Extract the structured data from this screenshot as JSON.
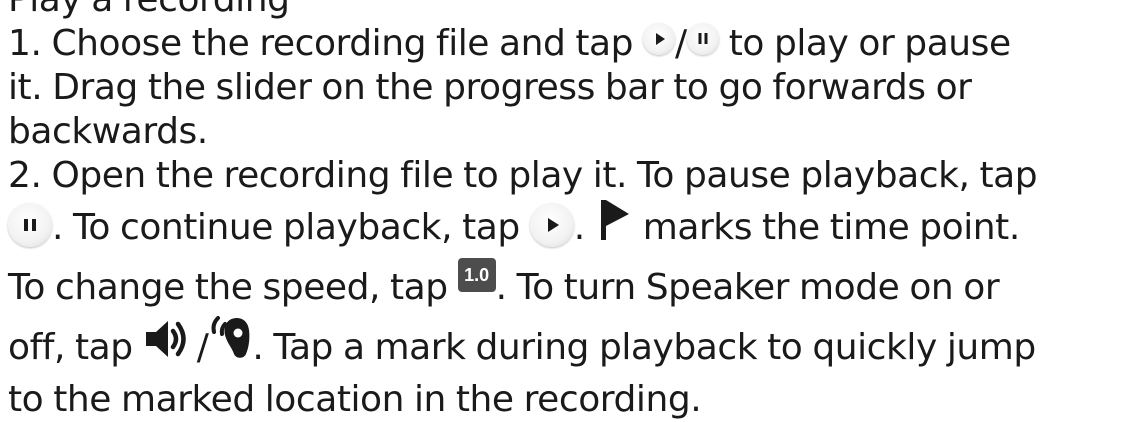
{
  "heading_partial": "Play a recording",
  "step1": {
    "before_icons": "1. Choose the recording file and tap ",
    "slash": "/",
    "after_icons": " to play or pause",
    "line2": "it. Drag the slider on the progress bar to go forwards or",
    "line3": "backwards."
  },
  "step2": {
    "line1": "2. Open the recording file to play it. To pause playback, tap",
    "after_pause": ". To continue playback, tap ",
    "after_play": ". ",
    "after_flag": " marks the time point.",
    "speed_before": "To change the speed, tap ",
    "speed_label": "1.0",
    "speed_after": ". To turn Speaker mode on or",
    "speaker_before": "off, tap ",
    "speaker_slash": "/",
    "speaker_after": ". Tap a mark during playback to quickly jump",
    "last_line": "to the marked location in the recording."
  },
  "icons": {
    "play": "play-button-icon",
    "pause": "pause-button-icon",
    "mark": "mark-flag-icon",
    "speed": "playback-speed-icon",
    "speaker": "speaker-mode-icon",
    "earpiece": "earpiece-mode-icon"
  },
  "colors": {
    "text": "#1a1a1a",
    "icon_dark": "#1a1a1a",
    "speed_badge": "#4d4d4d"
  }
}
